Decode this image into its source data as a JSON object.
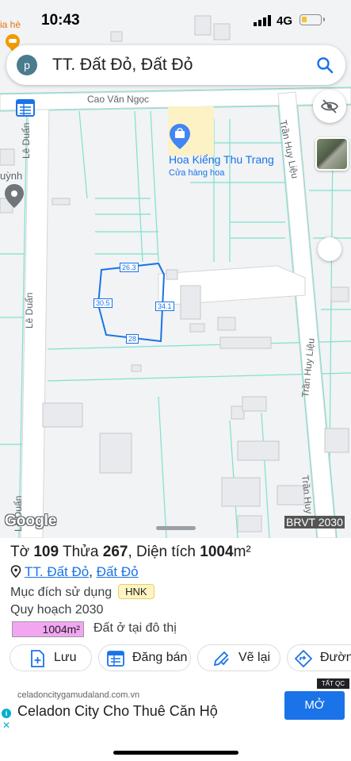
{
  "status": {
    "time": "10:43",
    "network": "4G",
    "battery_level": 0.3
  },
  "search": {
    "avatar_letter": "p",
    "query": "TT. Đất Đỏ, Đất Đỏ"
  },
  "map": {
    "streets": {
      "cao_van_ngoc": "Cao Văn Ngọc",
      "le_duan_top": "Lê Duẩn",
      "le_duan_mid": "Lê Duẩn",
      "le_duan_bottom": "Lê Duẩn",
      "tran_huy_lieu_top": "Trần Huy Liệu",
      "tran_huy_lieu_mid": "Trần Huy Liệu",
      "tran_huy_lieu_bottom": "Trần Huy"
    },
    "poi": {
      "name": "Hoa Kiểng Thu Trang",
      "category": "Cửa hàng hoa"
    },
    "partial_labels": {
      "top_left": "ia hè",
      "left": "uỳnh"
    },
    "parcel_edges": {
      "top": "26.3",
      "left": "30.5",
      "right": "34.1",
      "bottom": "28"
    },
    "google_logo": "Google",
    "region_code": "BRVT 2030"
  },
  "sheet": {
    "sheet_prefix": "Tờ ",
    "sheet_no": "109",
    "parcel_prefix": " Thửa ",
    "parcel_no": "267",
    "area_prefix": ", Diện tích ",
    "area_value": "1004",
    "area_unit": "m²",
    "location_town": "TT. Đất Đỏ",
    "location_sep": ", ",
    "location_district": "Đất Đỏ",
    "usage_label": "Mục đích sử dụng",
    "usage_code": "HNK",
    "planning_label": "Quy hoạch 2030",
    "planning_area": "1004m²",
    "planning_purpose": "Đất ở tại đô thị",
    "actions": {
      "save": "Lưu",
      "post_sale": "Đăng bán",
      "redraw": "Vẽ lại",
      "directions": "Đường"
    }
  },
  "ad": {
    "url": "celadoncitygamudaland.com.vn",
    "headline": "Celadon City Cho Thuê Căn Hộ",
    "cta": "MỞ",
    "badge": "TẤT QC"
  },
  "colors": {
    "accent": "#1a73e8",
    "parcel": "#1a73e8",
    "cadastral": "#7fe0d0",
    "tag_bg": "#fff4c2",
    "area_bar": "#f2a6f2"
  }
}
